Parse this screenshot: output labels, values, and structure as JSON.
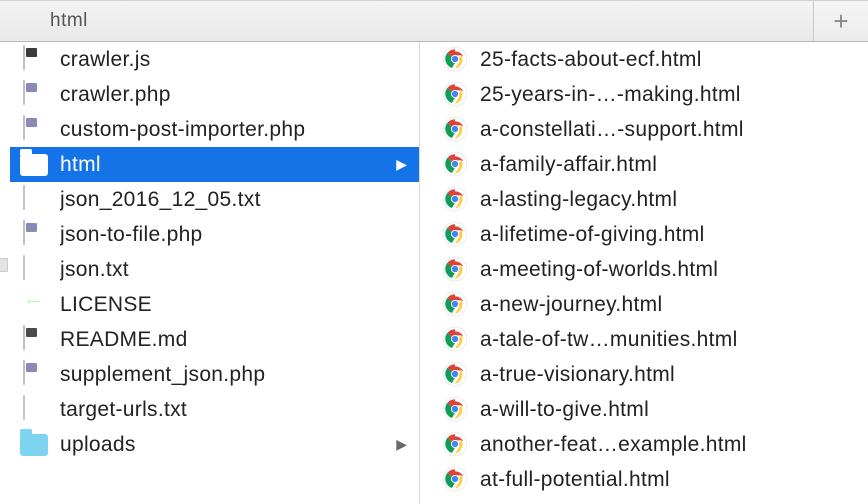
{
  "title": "html",
  "addTab": "+",
  "left": {
    "items": [
      {
        "kind": "js",
        "label": "crawler.js",
        "selected": false,
        "arrow": false
      },
      {
        "kind": "php",
        "label": "crawler.php",
        "selected": false,
        "arrow": false
      },
      {
        "kind": "php",
        "label": "custom-post-importer.php",
        "selected": false,
        "arrow": false
      },
      {
        "kind": "folder",
        "label": "html",
        "selected": true,
        "arrow": true
      },
      {
        "kind": "txt",
        "label": "json_2016_12_05.txt",
        "selected": false,
        "arrow": false
      },
      {
        "kind": "php",
        "label": "json-to-file.php",
        "selected": false,
        "arrow": false
      },
      {
        "kind": "txt",
        "label": "json.txt",
        "selected": false,
        "arrow": false
      },
      {
        "kind": "license",
        "label": "LICENSE",
        "selected": false,
        "arrow": false
      },
      {
        "kind": "md",
        "label": "README.md",
        "selected": false,
        "arrow": false
      },
      {
        "kind": "php",
        "label": "supplement_json.php",
        "selected": false,
        "arrow": false
      },
      {
        "kind": "txt",
        "label": "target-urls.txt",
        "selected": false,
        "arrow": false
      },
      {
        "kind": "folder",
        "label": "uploads",
        "selected": false,
        "arrow": true
      }
    ]
  },
  "right": {
    "items": [
      {
        "kind": "chrome",
        "label": "25-facts-about-ecf.html"
      },
      {
        "kind": "chrome",
        "label": "25-years-in-…-making.html"
      },
      {
        "kind": "chrome",
        "label": "a-constellati…-support.html"
      },
      {
        "kind": "chrome",
        "label": "a-family-affair.html"
      },
      {
        "kind": "chrome",
        "label": "a-lasting-legacy.html"
      },
      {
        "kind": "chrome",
        "label": "a-lifetime-of-giving.html"
      },
      {
        "kind": "chrome",
        "label": "a-meeting-of-worlds.html"
      },
      {
        "kind": "chrome",
        "label": "a-new-journey.html"
      },
      {
        "kind": "chrome",
        "label": "a-tale-of-tw…munities.html"
      },
      {
        "kind": "chrome",
        "label": "a-true-visionary.html"
      },
      {
        "kind": "chrome",
        "label": "a-will-to-give.html"
      },
      {
        "kind": "chrome",
        "label": "another-feat…example.html"
      },
      {
        "kind": "chrome",
        "label": "at-full-potential.html"
      }
    ]
  }
}
